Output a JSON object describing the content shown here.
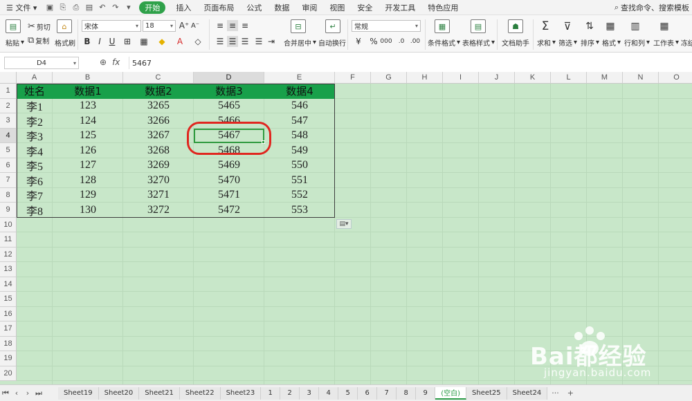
{
  "menubar": {
    "file": "文件",
    "tabs": [
      "开始",
      "插入",
      "页面布局",
      "公式",
      "数据",
      "审阅",
      "视图",
      "安全",
      "开发工具",
      "特色应用"
    ],
    "search": "查找命令、搜索模板"
  },
  "ribbon": {
    "paste": "粘贴",
    "cut": "剪切",
    "copy": "复制",
    "format_painter": "格式刷",
    "font_name": "宋体",
    "font_size": "18",
    "merge_center": "合并居中",
    "wrap_text": "自动换行",
    "number_format": "常规",
    "cond_format": "条件格式",
    "table_style": "表格样式",
    "doc_helper": "文档助手",
    "sum": "求和",
    "filter": "筛选",
    "sort": "排序",
    "format": "格式",
    "row_col": "行和列",
    "worksheet": "工作表",
    "freeze": "冻结"
  },
  "formula_bar": {
    "cell_ref": "D4",
    "value": "5467"
  },
  "columns": [
    "A",
    "B",
    "C",
    "D",
    "E",
    "F",
    "G",
    "H",
    "I",
    "J",
    "K",
    "L",
    "M",
    "N",
    "O"
  ],
  "rows": [
    "1",
    "2",
    "3",
    "4",
    "5",
    "6",
    "7",
    "8",
    "9",
    "10",
    "11",
    "12",
    "13",
    "14",
    "15",
    "16",
    "17",
    "18",
    "19",
    "20"
  ],
  "table": {
    "headers": [
      "姓名",
      "数据1",
      "数据2",
      "数据3",
      "数据4"
    ],
    "rows": [
      [
        "李1",
        "123",
        "3265",
        "5465",
        "546"
      ],
      [
        "李2",
        "124",
        "3266",
        "5466",
        "547"
      ],
      [
        "李3",
        "125",
        "3267",
        "5467",
        "548"
      ],
      [
        "李4",
        "126",
        "3268",
        "5468",
        "549"
      ],
      [
        "李5",
        "127",
        "3269",
        "5469",
        "550"
      ],
      [
        "李6",
        "128",
        "3270",
        "5470",
        "551"
      ],
      [
        "李7",
        "129",
        "3271",
        "5471",
        "552"
      ],
      [
        "李8",
        "130",
        "3272",
        "5472",
        "553"
      ]
    ]
  },
  "sheet_tabs": {
    "sheets": [
      "Sheet19",
      "Sheet20",
      "Sheet21",
      "Sheet22",
      "Sheet23",
      "1",
      "2",
      "3",
      "4",
      "5",
      "6",
      "7",
      "8",
      "9",
      "(空白)",
      "Sheet25",
      "Sheet24"
    ],
    "active": "(空白)",
    "more": "···",
    "add": "+"
  },
  "watermark": {
    "brand": "Bai都经验",
    "url": "jingyan.baidu.com"
  },
  "colors": {
    "accent": "#2fa14a",
    "grid_bg": "#c8e7c9",
    "header_fill": "#18a04a",
    "annotation": "#e0261f"
  }
}
